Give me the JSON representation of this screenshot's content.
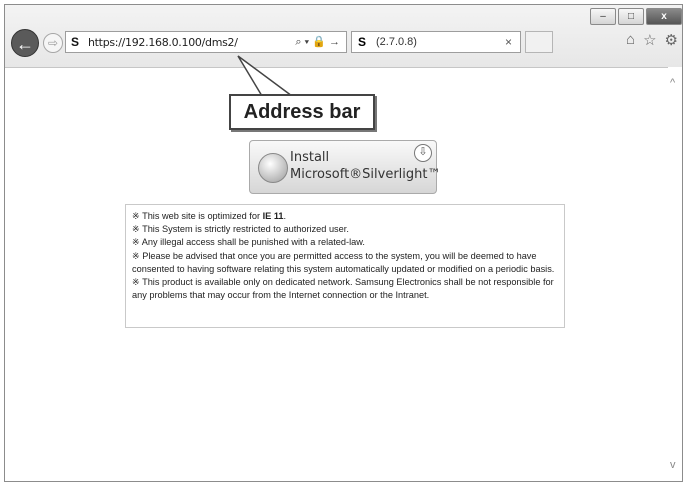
{
  "browser": {
    "back_icon": "back-arrow-icon",
    "forward_icon": "forward-arrow-icon",
    "address_bar": {
      "site_glyph": "S",
      "url": "https://192.168.0.100/dms2/",
      "tools": "⌕ ▾ 🔒 →"
    },
    "tab": {
      "site_glyph": "S",
      "title": "(2.7.0.8)",
      "close": "×"
    },
    "window_controls": {
      "minimize": "–",
      "maximize": "□",
      "close": "x"
    },
    "right_icons": {
      "home": "⌂",
      "favorites": "☆",
      "settings": "⚙"
    }
  },
  "callout": {
    "label": "Address bar"
  },
  "silverlight_button": {
    "line1": "Install",
    "line2": "Microsoft®Silverlight™",
    "download_icon": "⇩"
  },
  "notice": {
    "lines": [
      {
        "prefix": "※ This web site is optimized for ",
        "bold": "IE 11",
        "suffix": "."
      },
      "※ This System is strictly restricted to authorized user.",
      "※ Any illegal access shall be punished with a related-law.",
      "※ Please be advised that once you are permitted access to the system, you will be deemed to have consented to having software relating this system automatically updated or modified on a periodic basis.",
      "※ This product is available only on dedicated network. Samsung Electronics shall be not responsible for any problems that may occur from the Internet connection or the Intranet."
    ]
  },
  "scrollbar": {
    "up": "^",
    "down": "v"
  }
}
